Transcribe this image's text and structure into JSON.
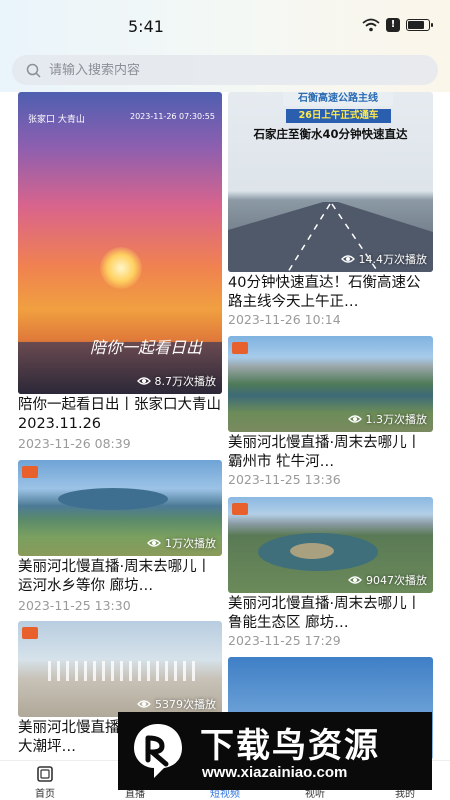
{
  "status_bar": {
    "time": "5:41",
    "battery_level": 0.85,
    "alert_glyph": "!"
  },
  "search": {
    "placeholder": "请输入搜索内容"
  },
  "feed_left": [
    {
      "title": "陪你一起看日出丨张家口大青山 2023.11.26",
      "date": "2023-11-26 08:39",
      "plays": "8.7万次播放",
      "overlay_location": "张家口 大青山",
      "overlay_timestamp": "2023-11-26 07:30:55",
      "overlay_caption": "陪你一起看日出"
    },
    {
      "title": "美丽河北慢直播·周末去哪儿丨运河水乡等你 廊坊…",
      "date": "2023-11-25 13:30",
      "plays": "1万次播放"
    },
    {
      "title": "美丽河北慢直播·周末去哪儿丨大潮坪…",
      "plays": "5379次播放"
    }
  ],
  "feed_right": [
    {
      "title": "40分钟快速直达！石衡高速公路主线今天上午正…",
      "date": "2023-11-26 10:14",
      "plays": "14.4万次播放",
      "overlay_banner": "石衡高速公路主线",
      "overlay_badge": "26日上午正式通车",
      "overlay_headline": "石家庄至衡水40分钟快速直达"
    },
    {
      "title": "美丽河北慢直播·周末去哪儿丨霸州市 牤牛河…",
      "date": "2023-11-25 13:36",
      "plays": "1.3万次播放"
    },
    {
      "title": "美丽河北慢直播·周末去哪儿丨鲁能生态区 廊坊…",
      "date": "2023-11-25 17:29",
      "plays": "9047次播放"
    },
    {}
  ],
  "tabs": [
    {
      "label": "首页",
      "icon": "home-icon",
      "active": false
    },
    {
      "label": "直播",
      "icon": "live-icon",
      "active": false
    },
    {
      "label": "短视频",
      "icon": "short-video-icon",
      "active": true
    },
    {
      "label": "视听",
      "icon": "audio-visual-icon",
      "active": false
    },
    {
      "label": "我的",
      "icon": "profile-icon",
      "active": false
    }
  ],
  "watermark": {
    "title": "下载鸟资源",
    "url": "www.xiazainiao.com"
  },
  "colors": {
    "accent": "#2d73e0",
    "date_gray": "#9a9a9a"
  }
}
